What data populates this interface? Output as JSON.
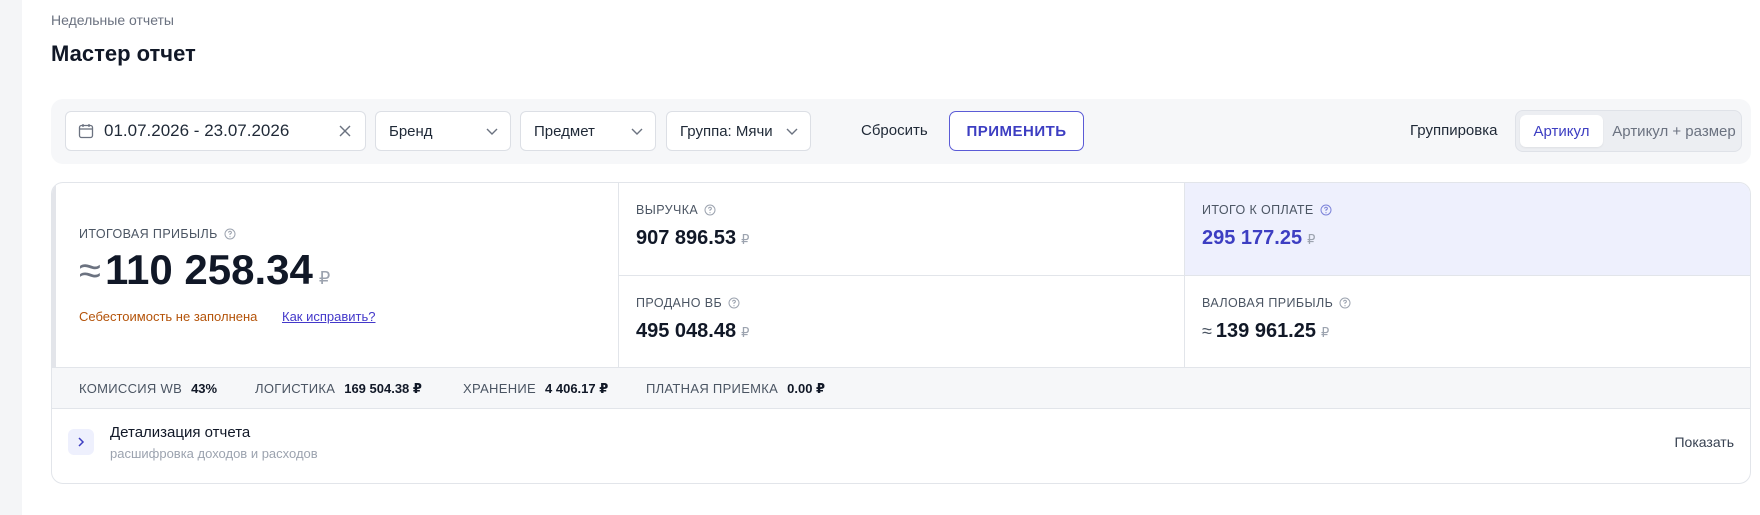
{
  "breadcrumb": "Недельные отчеты",
  "page_title": "Мастер отчет",
  "filters": {
    "date_range": "01.07.2026 - 23.07.2026",
    "brand": "Бренд",
    "subject": "Предмет",
    "group": "Группа: Мячи",
    "reset_label": "Сбросить",
    "apply_label": "ПРИМЕНИТЬ",
    "grouping_label": "Группировка",
    "grouping_options": [
      "Артикул",
      "Артикул + размер"
    ],
    "grouping_selected": "Артикул"
  },
  "summary": {
    "profit_label": "ИТОГОВАЯ ПРИБЫЛЬ",
    "profit_approx": "≈",
    "profit_value": "110 258.34",
    "currency": "₽",
    "warning": "Себестоимость не заполнена",
    "fix_link": "Как исправить?",
    "revenue_label": "ВЫРУЧКА",
    "revenue_value": "907 896.53",
    "sold_label": "ПРОДАНО ВБ",
    "sold_value": "495 048.48",
    "to_pay_label": "ИТОГО К ОПЛАТЕ",
    "to_pay_value": "295 177.25",
    "gross_label": "ВАЛОВАЯ ПРИБЫЛЬ",
    "gross_approx": "≈",
    "gross_value": "139 961.25"
  },
  "stats": [
    {
      "label": "КОМИССИЯ WB",
      "value": "43%"
    },
    {
      "label": "ЛОГИСТИКА",
      "value": "169 504.38 ₽"
    },
    {
      "label": "ХРАНЕНИЕ",
      "value": "4 406.17 ₽"
    },
    {
      "label": "ПЛАТНАЯ ПРИЕМКА",
      "value": "0.00 ₽"
    }
  ],
  "detail": {
    "title": "Детализация отчета",
    "subtitle": "расшифровка доходов и расходов",
    "show_label": "Показать"
  },
  "colors": {
    "accent": "#3d3ec2",
    "warning": "#b45309",
    "highlight_bg": "#eef0fd"
  }
}
